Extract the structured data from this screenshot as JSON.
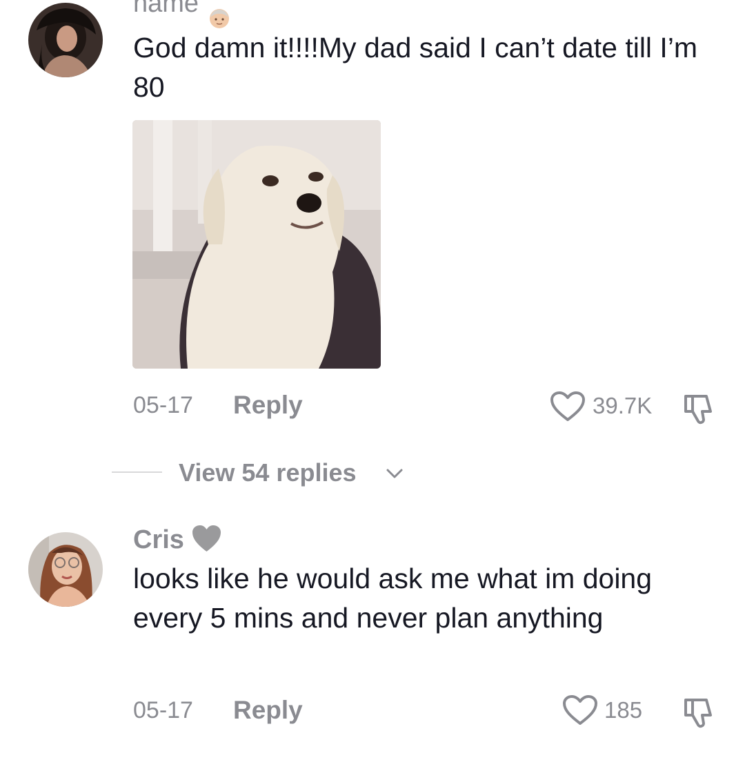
{
  "comments": [
    {
      "username": "name",
      "text": "God damn it!!!!My dad said I can’t date till I’m 80",
      "date": "05-17",
      "reply_label": "Reply",
      "likes": "39.7K",
      "has_image": true
    },
    {
      "username": "Cris",
      "text": "looks like he would ask me what im doing every 5 mins and never plan anything",
      "date": "05-17",
      "reply_label": "Reply",
      "likes": "185",
      "has_image": false
    }
  ],
  "view_replies_label": "View 54 replies",
  "colors": {
    "text": "#161823",
    "muted": "#8a8b91",
    "divider": "#d8d8da"
  },
  "icons": [
    "heart-outline-icon",
    "thumbs-down-icon",
    "chevron-down-icon",
    "grey-heart-emoji",
    "person-emoji"
  ]
}
